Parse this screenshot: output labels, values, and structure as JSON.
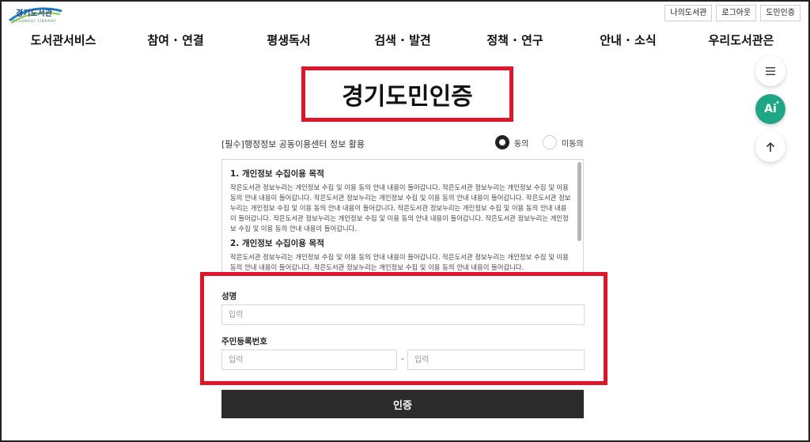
{
  "logo": {
    "name": "경기도서관",
    "sub": "GYEONGGI LIBRARY"
  },
  "util": [
    "나의도서관",
    "로그아웃",
    "도민인증"
  ],
  "gnb": [
    "도서관서비스",
    "참여 · 연결",
    "평생독서",
    "검색 · 발견",
    "정책 · 연구",
    "안내 · 소식",
    "우리도서관은"
  ],
  "page_title": "경기도민인증",
  "agree": {
    "label": "[필수]행정정보 공동이용센터 정보 활용",
    "agree_option": "동의",
    "disagree_option": "미동의"
  },
  "terms": {
    "h1": "1. 개인정보 수집이용 목적",
    "p1": "작은도서관 정보누리는 개인정보 수집 및 이용 동의 안내 내용이 들어갑니다. 작은도서관 정보누리는 개인정보 수집 및 이용 동의 안내 내용이 들어갑니다. 작은도서관 정보누리는 개인정보 수집 및 이용 동의 안내 내용이 들어갑니다. 작은도서관 정보누리는 개인정보 수집 및 이용 동의 안내 내용이 들어갑니다. 작은도서관 정보누리는 개인정보 수집 및 이용 동의 안내 내용이 들어갑니다. 작은도서관 정보누리는 개인정보 수집 및 이용 동의 안내 내용이 들어갑니다. 작은도서관 정보누리는 개인정보 수집 및 이용 동의 안내 내용이 들어갑니다.",
    "h2": "2. 개인정보 수집이용 목적",
    "p2": "작은도서관 정보누리는 개인정보 수집 및 이용 동의 안내 내용이 들어갑니다. 작은도서관 정보누리는 개인정보 수집 및 이용 동의 안내 내용이 들어갑니다. 작은도서관 정보누리는 개인정보 수집 및 이용 동의 안내 내용이 들어갑니다."
  },
  "form": {
    "name_label": "성명",
    "name_placeholder": "입력",
    "rrn_label": "주민등록번호",
    "rrn1_placeholder": "입력",
    "rrn_dash": "-",
    "rrn2_placeholder": "입력"
  },
  "submit_label": "인증",
  "floating": {
    "ai_label": "Ai",
    "menu_icon": "menu-icon",
    "top_icon": "arrow-up-icon"
  },
  "colors": {
    "highlight": "#e0142b",
    "button": "#2b2b2b",
    "ai": "#1fa785"
  }
}
